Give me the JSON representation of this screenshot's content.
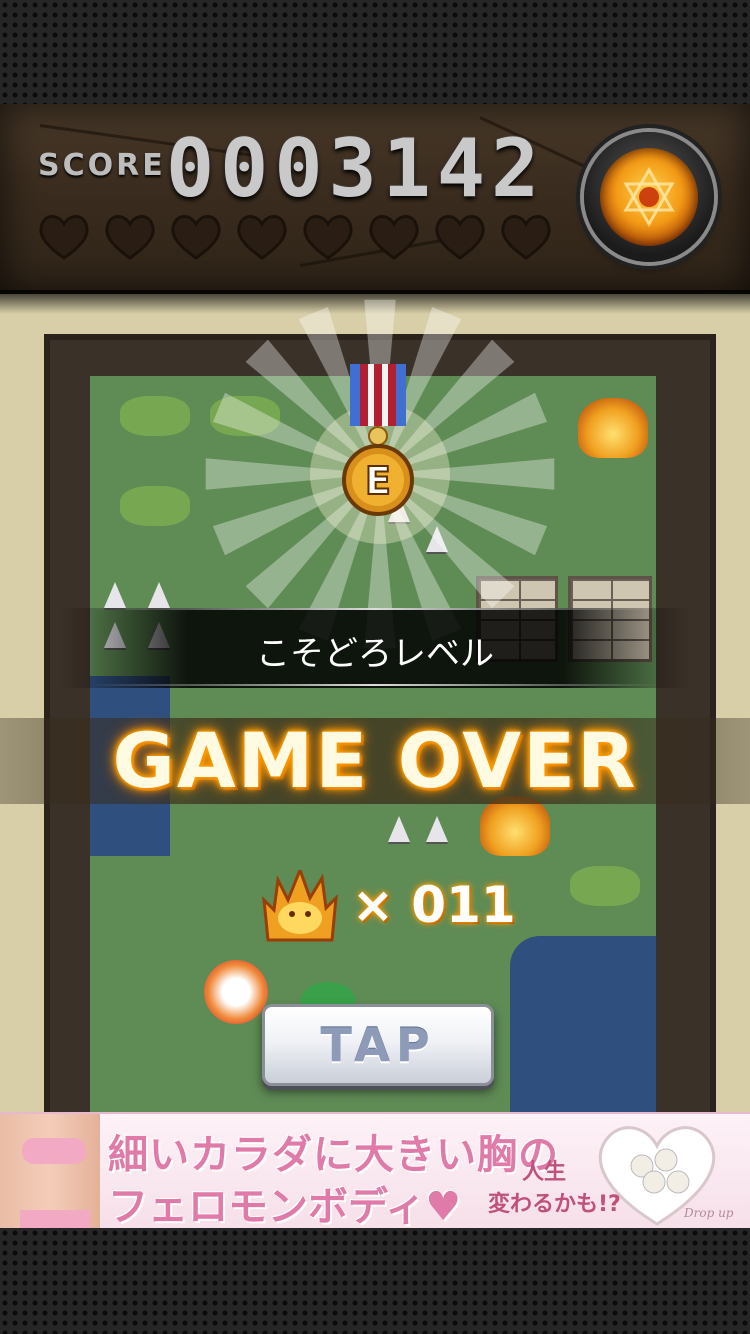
{
  "hud": {
    "score_label": "SCORE",
    "score_value": "0003142",
    "hearts_total": 8,
    "hearts_filled": 0,
    "emblem_icon": "hexagram-emblem-icon"
  },
  "result": {
    "medal_letter": "E",
    "level_title": "こそどろレベル",
    "game_over_text": "GAME OVER",
    "item_icon": "fire-creature-icon",
    "item_count_text": "× 011"
  },
  "tap_button": {
    "label": "TAP"
  },
  "ad": {
    "headline_1": "細いカラダに大きい胸の",
    "headline_2": "フェロモンボディ♥",
    "sub_1": "人生",
    "sub_2": "変わるかも!?",
    "brand": "Drop up"
  },
  "colors": {
    "game_over_glow": "#ff9a00",
    "tap_text": "#8d9bb8",
    "ad_pink": "#e07aa8",
    "medal_gold": "#f0a020"
  }
}
